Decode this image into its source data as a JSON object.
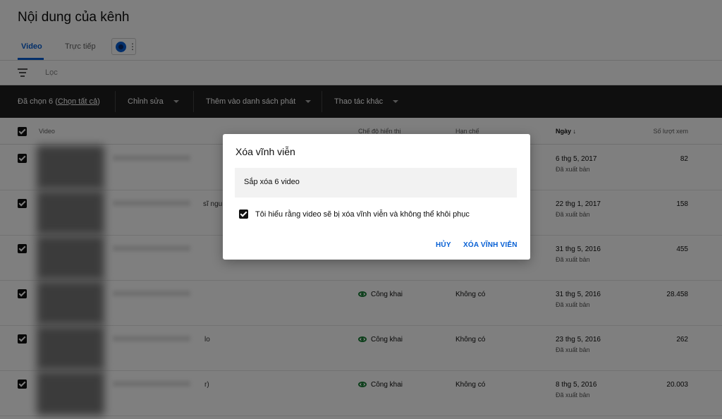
{
  "page": {
    "title": "Nội dung của kênh"
  },
  "tabs": [
    {
      "label": "Video"
    },
    {
      "label": "Trực tiếp"
    }
  ],
  "filter": {
    "placeholder": "Lọc"
  },
  "action_bar": {
    "selected_prefix": "Đã chọn 6 (",
    "select_all": "Chọn tất cả",
    "selected_suffix": ")",
    "edit": "Chỉnh sửa",
    "add_to_playlist": "Thêm vào danh sách phát",
    "more_actions": "Thao tác khác"
  },
  "table": {
    "headers": {
      "video": "Video",
      "visibility": "Chế độ hiển thị",
      "restrictions": "Hạn chế",
      "date": "Ngày ↓",
      "views": "Số lượt xem"
    },
    "rows": [
      {
        "title_tail": "",
        "visibility": "",
        "restrictions": "",
        "date": "6 thg 5, 2017",
        "status": "Đã xuất bản",
        "views": "82"
      },
      {
        "title_tail": "sĩ ngu",
        "visibility": "",
        "restrictions": "",
        "date": "22 thg 1, 2017",
        "status": "Đã xuất bản",
        "views": "158"
      },
      {
        "title_tail": "",
        "visibility": "",
        "restrictions": "",
        "date": "31 thg 5, 2016",
        "status": "Đã xuất bản",
        "views": "455"
      },
      {
        "title_tail": "",
        "visibility": "Công khai",
        "restrictions": "Không có",
        "date": "31 thg 5, 2016",
        "status": "Đã xuất bản",
        "views": "28.458"
      },
      {
        "title_tail": "lo",
        "visibility": "Công khai",
        "restrictions": "Không có",
        "date": "23 thg 5, 2016",
        "status": "Đã xuất bản",
        "views": "262"
      },
      {
        "title_tail": "r)",
        "visibility": "Công khai",
        "restrictions": "Không có",
        "date": "8 thg 5, 2016",
        "status": "Đã xuất bản",
        "views": "20.003"
      }
    ]
  },
  "dialog": {
    "title": "Xóa vĩnh viễn",
    "message": "Sắp xóa 6 video",
    "confirm_label": "Tôi hiểu rằng video sẽ bị xóa vĩnh viễn và không thể khôi phục",
    "cancel": "HỦY",
    "delete": "XÓA VĨNH VIỄN"
  },
  "colors": {
    "accent": "#065fd4",
    "action_bar": "#1f1f1f",
    "public_icon": "#1a7f37"
  }
}
